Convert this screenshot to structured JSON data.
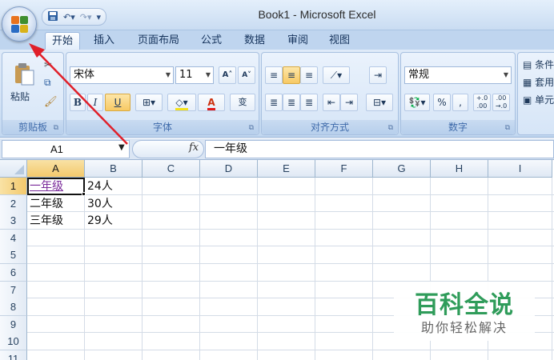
{
  "window": {
    "title": "Book1 - Microsoft Excel"
  },
  "qat": {
    "save_icon": "save-icon",
    "undo_icon": "undo-icon",
    "redo_icon": "redo-icon",
    "customize_glyph": "▾"
  },
  "tabs": [
    {
      "label": "开始",
      "active": true
    },
    {
      "label": "插入",
      "active": false
    },
    {
      "label": "页面布局",
      "active": false
    },
    {
      "label": "公式",
      "active": false
    },
    {
      "label": "数据",
      "active": false
    },
    {
      "label": "审阅",
      "active": false
    },
    {
      "label": "视图",
      "active": false
    }
  ],
  "ribbon": {
    "clipboard": {
      "label": "剪贴板",
      "paste_label": "粘贴"
    },
    "font": {
      "label": "字体",
      "font_name": "宋体",
      "font_size": "11",
      "bold": "B",
      "italic": "I",
      "underline": "U",
      "font_color_glyph": "A",
      "grow": "A˄",
      "shrink": "A˅",
      "phonetic": "变"
    },
    "alignment": {
      "label": "对齐方式"
    },
    "number": {
      "label": "数字",
      "format": "常规",
      "percent": "%",
      "comma": ",",
      "inc_dec": "+.0 .00",
      "dec_dec": ".00 →.0"
    },
    "styles": {
      "cond_format": "条件",
      "table_format": "套用",
      "cell_styles": "单元"
    }
  },
  "formula_bar": {
    "name_box": "A1",
    "fx": "fx",
    "content": "一年级"
  },
  "sheet": {
    "columns": [
      "A",
      "B",
      "C",
      "D",
      "E",
      "F",
      "G",
      "H",
      "I"
    ],
    "selected_column": "A",
    "rows": [
      "1",
      "2",
      "3",
      "4",
      "5",
      "6",
      "7",
      "8",
      "9",
      "10",
      "11"
    ],
    "selected_row": "1",
    "cells": [
      {
        "ref": "A1",
        "value": "一年级",
        "active": true
      },
      {
        "ref": "B1",
        "value": "24人"
      },
      {
        "ref": "A2",
        "value": "二年级"
      },
      {
        "ref": "B2",
        "value": "30人"
      },
      {
        "ref": "A3",
        "value": "三年级"
      },
      {
        "ref": "B3",
        "value": "29人"
      }
    ]
  },
  "watermark": {
    "title": "百科全说",
    "subtitle": "助你轻松解决"
  },
  "colors": {
    "accent_arrow": "#e0202a",
    "watermark_green": "#2f9c5a",
    "selection_header": "#f3c96c"
  }
}
